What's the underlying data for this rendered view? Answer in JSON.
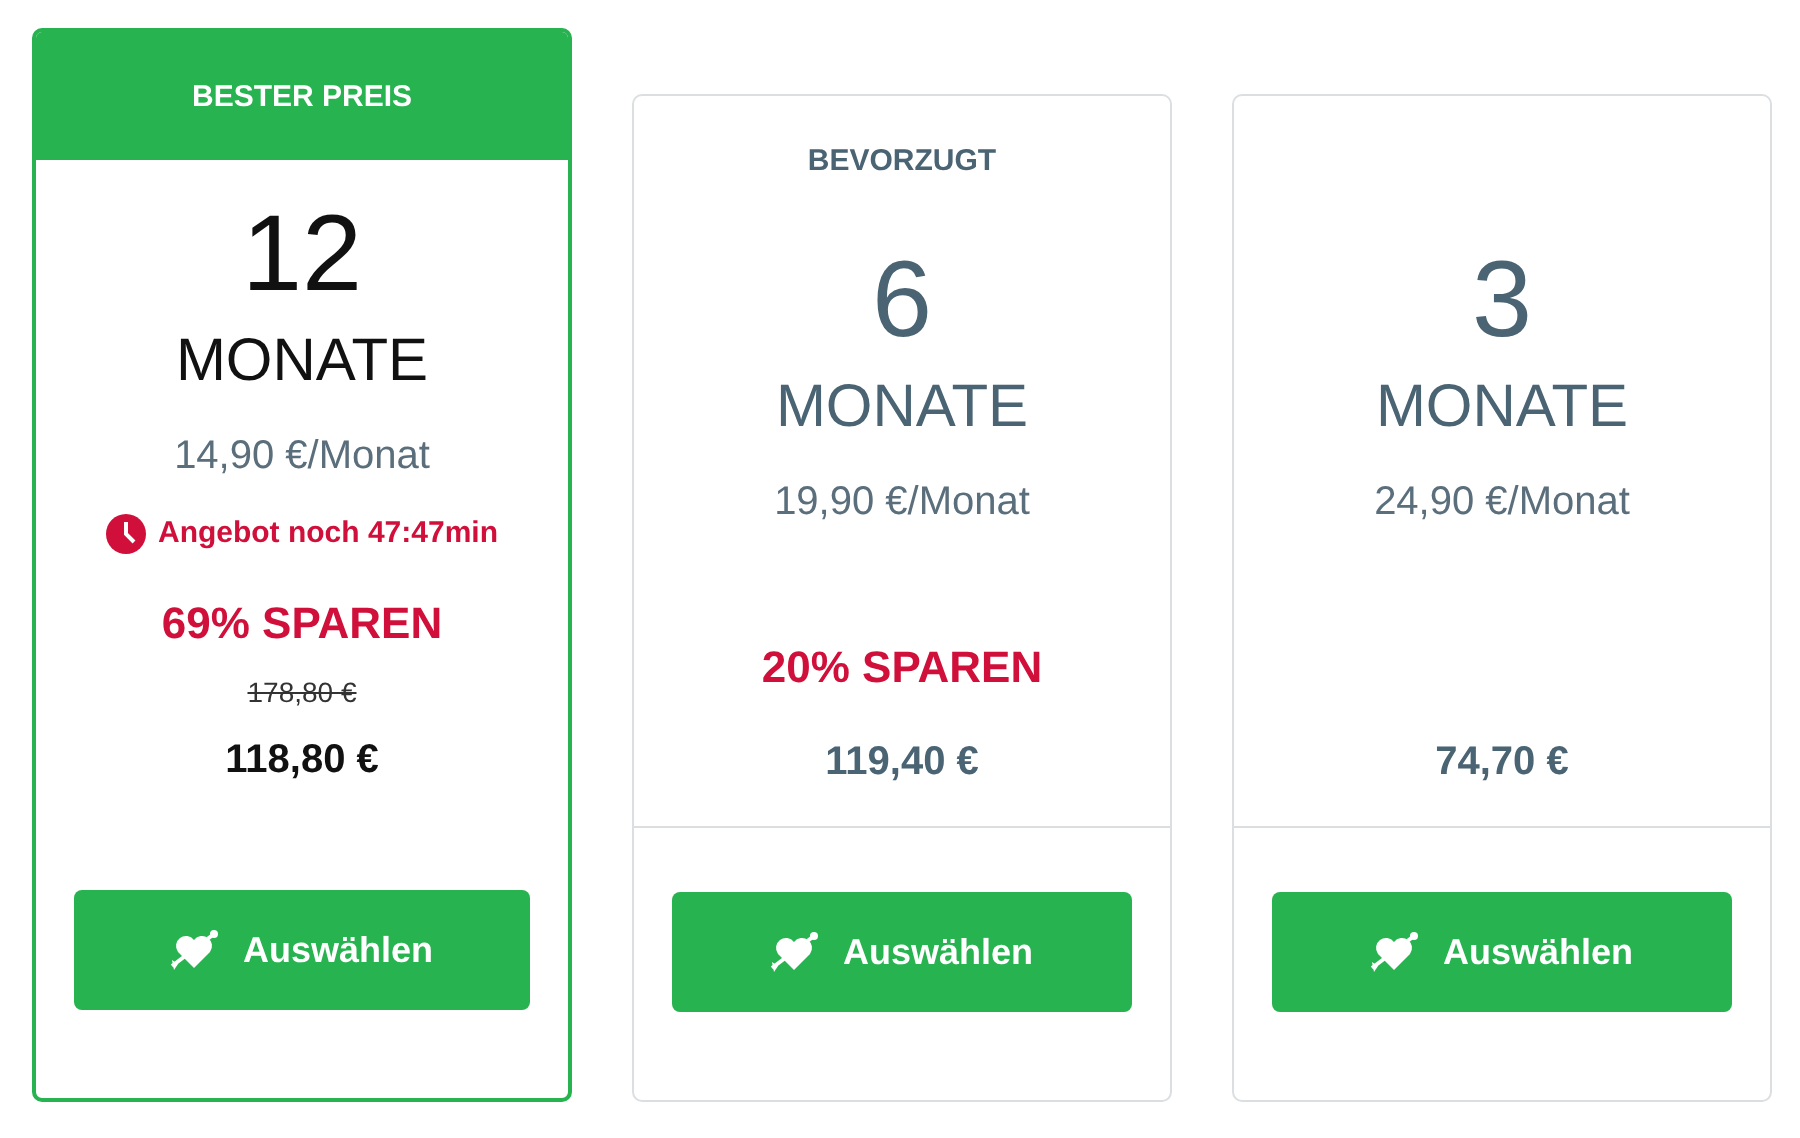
{
  "plans": [
    {
      "kind": "featured",
      "label": "BESTER PREIS",
      "count": "12",
      "unit": "MONATE",
      "monthly": "14,90 €/Monat",
      "timer": "Angebot noch 47:47min",
      "savings": "69% SPAREN",
      "old_price": "178,80 €",
      "total": "118,80 €",
      "button": "Auswählen"
    },
    {
      "kind": "standard",
      "label": "BEVORZUGT",
      "count": "6",
      "unit": "MONATE",
      "monthly": "19,90 €/Monat",
      "savings": "20% SPAREN",
      "total": "119,40 €",
      "button": "Auswählen"
    },
    {
      "kind": "standard",
      "count": "3",
      "unit": "MONATE",
      "monthly": "24,90 €/Monat",
      "total": "74,70 €",
      "button": "Auswählen"
    }
  ]
}
